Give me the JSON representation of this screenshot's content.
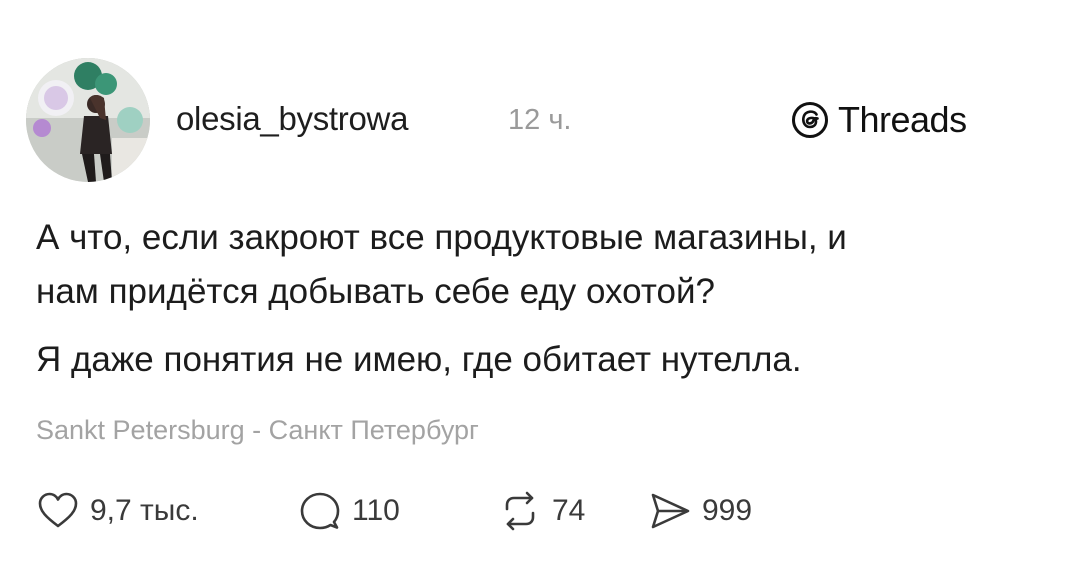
{
  "post": {
    "author": "olesia_bystrowa",
    "time": "12 ч.",
    "brand": "Threads",
    "lines": [
      "А что, если закроют все продуктовые магазины, и",
      "нам придётся добывать себе еду охотой?",
      "Я даже понятия не имею, где обитает нутелла."
    ],
    "location": "Sankt Petersburg - Санкт Петербург",
    "actions": {
      "likes": "9,7 тыс.",
      "replies": "110",
      "reposts": "74",
      "shares": "999"
    },
    "icons": {
      "avatar": "avatar-photo",
      "brand": "threads-logo-icon",
      "like": "heart-icon",
      "reply": "comment-icon",
      "repost": "repost-icon",
      "share": "send-icon"
    }
  }
}
